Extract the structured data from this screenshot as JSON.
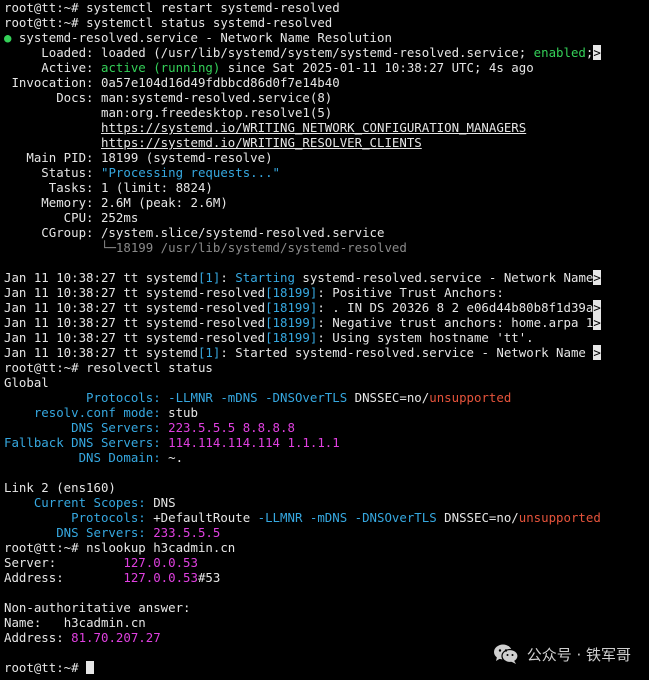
{
  "prompt": "root@tt:~# ",
  "cmd1": "systemctl restart systemd-resolved",
  "cmd2": "systemctl status systemd-resolved",
  "status": {
    "dot": "●",
    "unit_line": " systemd-resolved.service - Network Name Resolution",
    "loaded_label": "     Loaded: ",
    "loaded_value": "loaded (/usr/lib/systemd/system/systemd-resolved.service; ",
    "loaded_enabled": "enabled",
    "loaded_tail": ";",
    "loaded_overflow": ">",
    "active_label": "     Active: ",
    "active_value": "active (running)",
    "active_tail": " since Sat 2025-01-11 10:38:27 UTC; 4s ago",
    "invocation": " Invocation: 0a57e104d16d49fdbbcd86d0f7e14b40",
    "docs_label": "       Docs: ",
    "docs_1": "man:systemd-resolved.service(8)",
    "docs_indent": "             ",
    "docs_2": "man:org.freedesktop.resolve1(5)",
    "docs_3": "https://systemd.io/WRITING_NETWORK_CONFIGURATION_MANAGERS",
    "docs_4": "https://systemd.io/WRITING_RESOLVER_CLIENTS",
    "mainpid": "   Main PID: 18199 (systemd-resolve)",
    "status_label": "     Status: ",
    "status_value": "\"Processing requests...\"",
    "tasks": "      Tasks: 1 (limit: 8824)",
    "memory": "     Memory: 2.6M (peak: 2.6M)",
    "cpu": "        CPU: 252ms",
    "cgroup": "     CGroup: /system.slice/systemd-resolved.service",
    "cgroup_child_indent": "             ",
    "cgroup_child": "└─18199 /usr/lib/systemd/systemd-resolved"
  },
  "journal": [
    {
      "pre": "Jan 11 10:38:27 tt systemd",
      "pid": "[1]",
      "msg": ": ",
      "hl": "Starting",
      "rest": " systemd-resolved.service - Network Name",
      "ov": ">"
    },
    {
      "pre": "Jan 11 10:38:27 tt systemd-resolved",
      "pid": "[18199]",
      "msg": ": Positive Trust Anchors:",
      "hl": "",
      "rest": "",
      "ov": ""
    },
    {
      "pre": "Jan 11 10:38:27 tt systemd-resolved",
      "pid": "[18199]",
      "msg": ": . IN DS 20326 8 2 e06d44b80b8f1d39a",
      "hl": "",
      "rest": "",
      "ov": ">"
    },
    {
      "pre": "Jan 11 10:38:27 tt systemd-resolved",
      "pid": "[18199]",
      "msg": ": Negative trust anchors: home.arpa 1",
      "hl": "",
      "rest": "",
      "ov": ">"
    },
    {
      "pre": "Jan 11 10:38:27 tt systemd-resolved",
      "pid": "[18199]",
      "msg": ": Using system hostname 'tt'.",
      "hl": "",
      "rest": "",
      "ov": ""
    },
    {
      "pre": "Jan 11 10:38:27 tt systemd",
      "pid": "[1]",
      "msg": ": Started systemd-resolved.service - Network Name ",
      "hl": "",
      "rest": "",
      "ov": ">"
    }
  ],
  "cmd3": "resolvectl status",
  "resolve": {
    "global": "Global",
    "g_proto_label": "           Protocols: ",
    "g_proto_value": "-LLMNR -mDNS -DNSOverTLS",
    "g_dnssec": " DNSSEC=no/",
    "g_unsupported": "unsupported",
    "g_mode_label": "    resolv.conf mode: ",
    "g_mode_value": "stub",
    "g_dns_label": "         DNS Servers: ",
    "g_dns_value": "223.5.5.5 8.8.8.8",
    "g_fallback_label": "Fallback DNS Servers: ",
    "g_fallback_value": "114.114.114.114 1.1.1.1",
    "g_domain_label": "          DNS Domain: ",
    "g_domain_value": "~.",
    "link": "Link 2 (ens160)",
    "l_scopes_label": "    Current Scopes: ",
    "l_scopes_value": "DNS",
    "l_proto_label": "         Protocols: ",
    "l_proto_plus": "+DefaultRoute ",
    "l_proto_value": "-LLMNR -mDNS -DNSOverTLS",
    "l_dnssec": " DNSSEC=no/",
    "l_unsupported": "unsupported",
    "l_dns_label": "       DNS Servers: ",
    "l_dns_value": "233.5.5.5"
  },
  "cmd4": "nslookup h3cadmin.cn",
  "nslookup": {
    "server_label": "Server:         ",
    "server_value": "127.0.0.53",
    "address_label": "Address:        ",
    "address_value": "127.0.0.53",
    "address_port": "#53",
    "nonauth": "Non-authoritative answer:",
    "name_label": "Name:   ",
    "name_value": "h3cadmin.cn",
    "ans_label": "Address: ",
    "ans_value": "81.70.207.27"
  },
  "watermark": {
    "icon": "wechat-icon",
    "text": "公众号 · 铁军哥"
  }
}
